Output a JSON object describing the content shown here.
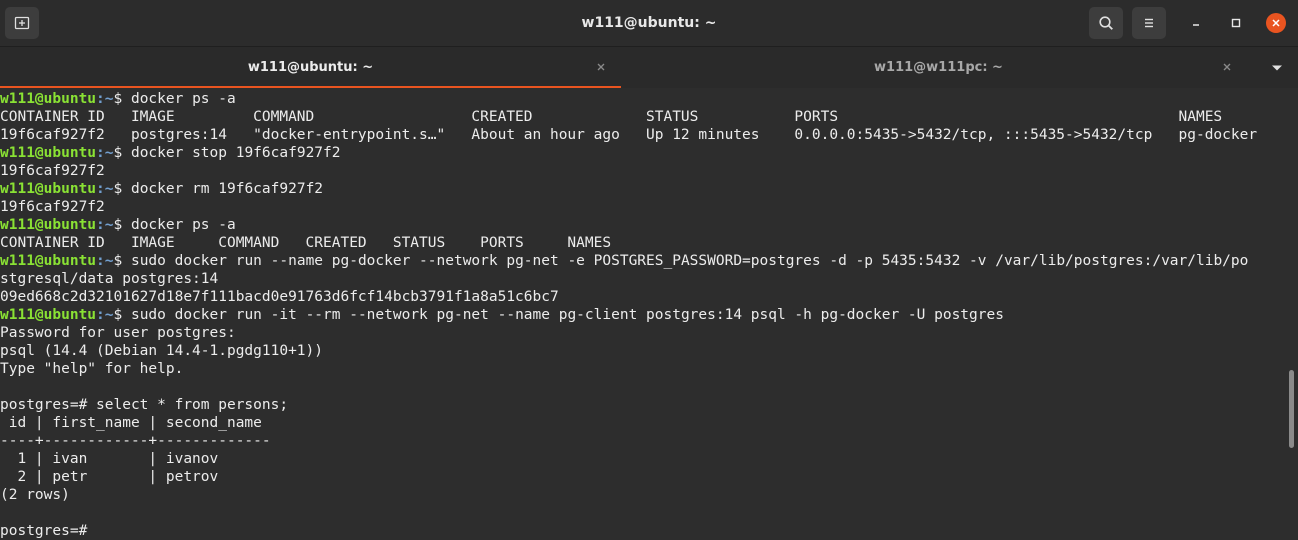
{
  "window": {
    "title": "w111@ubuntu: ~",
    "new_tab_icon": "new-tab-icon",
    "search_icon": "search-icon",
    "menu_icon": "hamburger-menu-icon",
    "minimize_icon": "minimize-icon",
    "maximize_icon": "maximize-icon",
    "close_icon": "close-icon",
    "accent_color": "#e95420",
    "close_button_color": "#e95420"
  },
  "tabs": [
    {
      "label": "w111@ubuntu: ~",
      "active": true
    },
    {
      "label": "w111@w111pc: ~",
      "active": false
    }
  ],
  "terminal": {
    "prompt_user": "w111@ubuntu",
    "prompt_path": ":~",
    "prompt_symbol": "$ ",
    "prompt_color": "#8ae234",
    "path_color": "#729fcf",
    "lines": [
      {
        "cmd": "docker ps -a"
      },
      {
        "out": "CONTAINER ID   IMAGE         COMMAND                  CREATED             STATUS           PORTS                                       NAMES"
      },
      {
        "out": "19f6caf927f2   postgres:14   \"docker-entrypoint.s…\"   About an hour ago   Up 12 minutes    0.0.0.0:5435->5432/tcp, :::5435->5432/tcp   pg-docker"
      },
      {
        "cmd": "docker stop 19f6caf927f2"
      },
      {
        "out": "19f6caf927f2"
      },
      {
        "cmd": "docker rm 19f6caf927f2"
      },
      {
        "out": "19f6caf927f2"
      },
      {
        "cmd": "docker ps -a"
      },
      {
        "out": "CONTAINER ID   IMAGE     COMMAND   CREATED   STATUS    PORTS     NAMES"
      },
      {
        "cmd": "sudo docker run --name pg-docker --network pg-net -e POSTGRES_PASSWORD=postgres -d -p 5435:5432 -v /var/lib/postgres:/var/lib/po"
      },
      {
        "out": "stgresql/data postgres:14"
      },
      {
        "out": "09ed668c2d32101627d18e7f111bacd0e91763d6fcf14bcb3791f1a8a51c6bc7"
      },
      {
        "cmd": "sudo docker run -it --rm --network pg-net --name pg-client postgres:14 psql -h pg-docker -U postgres"
      },
      {
        "out": "Password for user postgres:"
      },
      {
        "out": "psql (14.4 (Debian 14.4-1.pgdg110+1))"
      },
      {
        "out": "Type \"help\" for help."
      },
      {
        "out": ""
      },
      {
        "out": "postgres=# select * from persons;"
      },
      {
        "out": " id | first_name | second_name"
      },
      {
        "out": "----+------------+-------------"
      },
      {
        "out": "  1 | ivan       | ivanov"
      },
      {
        "out": "  2 | petr       | petrov"
      },
      {
        "out": "(2 rows)"
      },
      {
        "out": ""
      },
      {
        "out": "postgres=#"
      }
    ]
  }
}
